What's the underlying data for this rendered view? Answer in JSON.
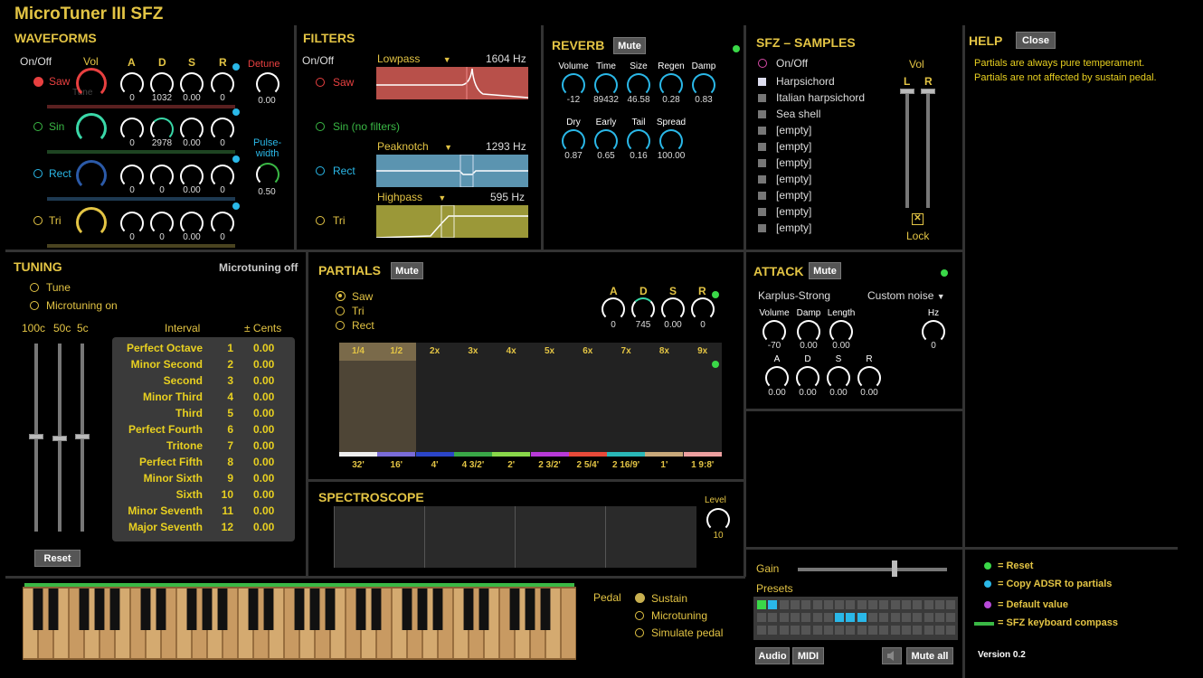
{
  "app": {
    "title": "MicroTuner III SFZ",
    "version": "Version 0.2"
  },
  "waveforms": {
    "title": "WAVEFORMS",
    "onoff": "On/Off",
    "vol": "Vol",
    "a": "A",
    "d": "D",
    "s": "S",
    "r": "R",
    "detune": "Detune",
    "detune_val": "0.00",
    "tune_ghost": "Tune",
    "pulsewidth": "Pulse-\nwidth",
    "pulse_val": "0.50",
    "rows": [
      {
        "name": "Saw",
        "a": "0",
        "d": "1032",
        "s": "0.00",
        "r": "0",
        "color": "#e84040"
      },
      {
        "name": "Sin",
        "a": "0",
        "d": "2978",
        "s": "0.00",
        "r": "0",
        "color": "#3ab845"
      },
      {
        "name": "Rect",
        "a": "0",
        "d": "0",
        "s": "0.00",
        "r": "0",
        "color": "#2ab8e8"
      },
      {
        "name": "Tri",
        "a": "0",
        "d": "0",
        "s": "0.00",
        "r": "0",
        "color": "#e3c444"
      }
    ]
  },
  "filters": {
    "title": "FILTERS",
    "onoff": "On/Off",
    "saw": "Saw",
    "sin": "Sin (no filters)",
    "rect": "Rect",
    "tri": "Tri",
    "lowpass": "Lowpass",
    "lowpass_hz": "1604 Hz",
    "peaknotch": "Peaknotch",
    "peaknotch_hz": "1293 Hz",
    "highpass": "Highpass",
    "highpass_hz": "595 Hz"
  },
  "reverb": {
    "title": "REVERB",
    "mute": "Mute",
    "knobs": [
      {
        "l": "Volume",
        "v": "-12"
      },
      {
        "l": "Time",
        "v": "89432"
      },
      {
        "l": "Size",
        "v": "46.58"
      },
      {
        "l": "Regen",
        "v": "0.28"
      },
      {
        "l": "Damp",
        "v": "0.83"
      },
      {
        "l": "Dry",
        "v": "0.87"
      },
      {
        "l": "Early",
        "v": "0.65"
      },
      {
        "l": "Tail",
        "v": "0.16"
      },
      {
        "l": "Spread",
        "v": "100.00"
      }
    ]
  },
  "sfz": {
    "title": "SFZ – SAMPLES",
    "onoff": "On/Off",
    "vol": "Vol",
    "l": "L",
    "r": "R",
    "lock": "Lock",
    "lock_mark": "✕",
    "samples": [
      "Harpsichord",
      "Italian harpsichord",
      "Sea shell",
      "[empty]",
      "[empty]",
      "[empty]",
      "[empty]",
      "[empty]",
      "[empty]",
      "[empty]"
    ]
  },
  "help": {
    "title": "HELP",
    "close": "Close",
    "text": "Partials are always pure temperament. Partials are not affected by sustain pedal."
  },
  "tuning": {
    "title": "TUNING",
    "microtuning_off": "Microtuning off",
    "tune": "Tune",
    "microtuning_on": "Microtuning on",
    "c100": "100c",
    "c50": "50c",
    "c5": "5c",
    "interval": "Interval",
    "cents": "± Cents",
    "reset": "Reset",
    "intervals": [
      {
        "n": "Perfect Octave",
        "i": "1",
        "c": "0.00"
      },
      {
        "n": "Minor Second",
        "i": "2",
        "c": "0.00"
      },
      {
        "n": "Second",
        "i": "3",
        "c": "0.00"
      },
      {
        "n": "Minor Third",
        "i": "4",
        "c": "0.00"
      },
      {
        "n": "Third",
        "i": "5",
        "c": "0.00"
      },
      {
        "n": "Perfect Fourth",
        "i": "6",
        "c": "0.00"
      },
      {
        "n": "Tritone",
        "i": "7",
        "c": "0.00"
      },
      {
        "n": "Perfect Fifth",
        "i": "8",
        "c": "0.00"
      },
      {
        "n": "Minor Sixth",
        "i": "9",
        "c": "0.00"
      },
      {
        "n": "Sixth",
        "i": "10",
        "c": "0.00"
      },
      {
        "n": "Minor Seventh",
        "i": "11",
        "c": "0.00"
      },
      {
        "n": "Major Seventh",
        "i": "12",
        "c": "0.00"
      }
    ]
  },
  "partials": {
    "title": "PARTIALS",
    "mute": "Mute",
    "saw": "Saw",
    "tri": "Tri",
    "rect": "Rect",
    "a": "A",
    "d": "D",
    "s": "S",
    "r": "R",
    "av": "0",
    "dv": "745",
    "sv": "0.00",
    "rv": "0",
    "top_labels": [
      "1/4",
      "1/2",
      "2x",
      "3x",
      "4x",
      "5x",
      "6x",
      "7x",
      "8x",
      "9x"
    ],
    "bottom_labels": [
      "32'",
      "16'",
      "4'",
      "4 3/2'",
      "2'",
      "2 3/2'",
      "2 5/4'",
      "2 16/9'",
      "1'",
      "1 9:8'"
    ],
    "bar_colors": [
      "#eee",
      "#7a6cd8",
      "#2b45c8",
      "#3aa848",
      "#8ad84a",
      "#b83ad8",
      "#e84a3a",
      "#2ab8b8",
      "#c8a87a",
      "#eea0a0"
    ]
  },
  "spectroscope": {
    "title": "SPECTROSCOPE",
    "level": "Level",
    "level_val": "10"
  },
  "attack": {
    "title": "ATTACK",
    "mute": "Mute",
    "karplus": "Karplus-Strong",
    "custom_noise": "Custom noise",
    "knobs": [
      {
        "l": "Volume",
        "v": "-70"
      },
      {
        "l": "Damp",
        "v": "0.00"
      },
      {
        "l": "Length",
        "v": "0.00"
      },
      {
        "l": "Hz",
        "v": "0"
      }
    ],
    "adsr": [
      {
        "l": "A",
        "v": "0.00"
      },
      {
        "l": "D",
        "v": "0.00"
      },
      {
        "l": "S",
        "v": "0.00"
      },
      {
        "l": "R",
        "v": "0.00"
      }
    ]
  },
  "bottom": {
    "pedal": "Pedal",
    "sustain": "Sustain",
    "microtuning": "Microtuning",
    "simulate": "Simulate pedal",
    "gain": "Gain",
    "presets": "Presets",
    "audio": "Audio",
    "midi": "MIDI",
    "mute_all": "Mute all"
  },
  "legend": {
    "reset": "= Reset",
    "copy": "= Copy ADSR to partials",
    "default": "= Default value",
    "compass": "= SFZ keyboard compass"
  }
}
